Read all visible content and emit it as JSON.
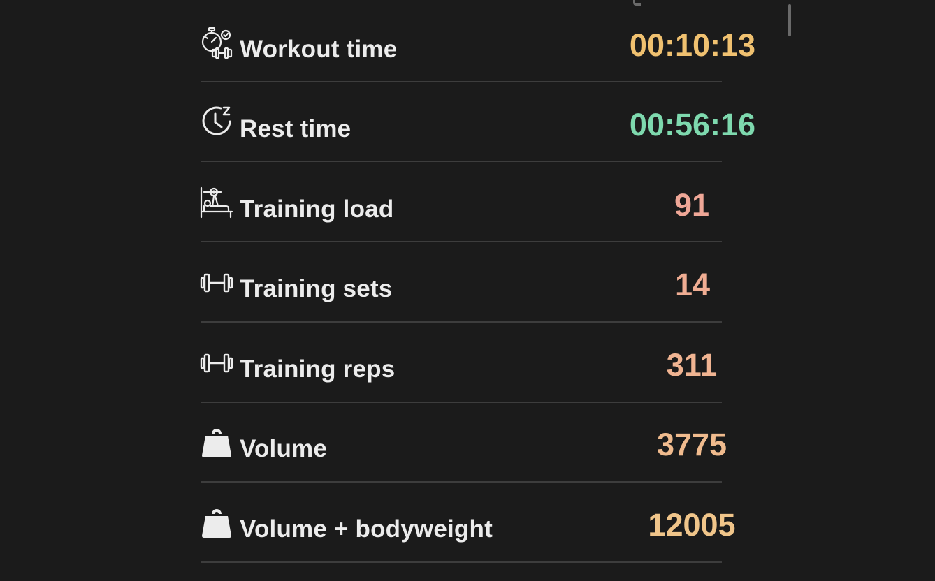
{
  "stats": [
    {
      "label": "Workout time",
      "value": "00:10:13",
      "icon": "stopwatch-dumbbell-icon",
      "color": "#f0c170"
    },
    {
      "label": "Rest time",
      "value": "00:56:16",
      "icon": "clock-sleep-icon",
      "color": "#7ed9ae"
    },
    {
      "label": "Training load",
      "value": "91",
      "icon": "bench-press-icon",
      "color": "#efa797"
    },
    {
      "label": "Training sets",
      "value": "14",
      "icon": "dumbbell-icon",
      "color": "#f0ad93"
    },
    {
      "label": "Training reps",
      "value": "311",
      "icon": "dumbbell-icon",
      "color": "#f0b492"
    },
    {
      "label": "Volume",
      "value": "3775",
      "icon": "kettlebell-weight-icon",
      "color": "#f0bb8e"
    },
    {
      "label": "Volume + bodyweight",
      "value": "12005",
      "icon": "kettlebell-weight-icon",
      "color": "#f0c58a"
    }
  ]
}
